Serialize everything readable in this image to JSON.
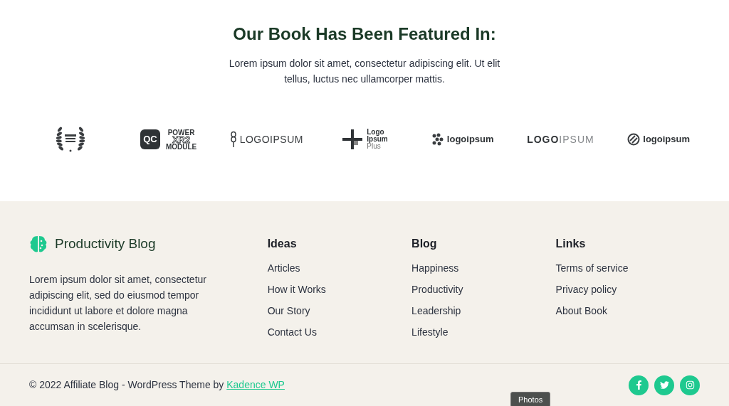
{
  "featured": {
    "title": "Our Book Has Been Featured In:",
    "text": "Lorem ipsum dolor sit amet, consectetur adipiscing elit. Ut elit tellus, luctus nec ullamcorper mattis.",
    "logos": [
      {
        "kind": "laurel"
      },
      {
        "kind": "qc",
        "badge": "QC",
        "lines": [
          "POWER",
          "XR2",
          "MODULE"
        ]
      },
      {
        "kind": "wheat",
        "lines": [
          "LOGOIPSUM"
        ]
      },
      {
        "kind": "cross",
        "lines": [
          "Logo",
          "Ipsum",
          "Plus"
        ]
      },
      {
        "kind": "dots",
        "lines": [
          "logoipsum"
        ]
      },
      {
        "kind": "split",
        "lines": [
          "LOGO",
          "IPSUM"
        ]
      },
      {
        "kind": "circle",
        "lines": [
          "logoipsum"
        ]
      }
    ]
  },
  "footer": {
    "brand": "Productivity Blog",
    "about": "Lorem ipsum dolor sit amet, consectetur adipiscing elit, sed do eiusmod tempor incididunt ut labore et dolore magna accumsan in scelerisque.",
    "columns": [
      {
        "title": "Ideas",
        "links": [
          "Articles",
          "How it Works",
          "Our Story",
          "Contact Us"
        ]
      },
      {
        "title": "Blog",
        "links": [
          "Happiness",
          "Productivity",
          "Leadership",
          "Lifestyle"
        ]
      },
      {
        "title": "Links",
        "links": [
          "Terms of service",
          "Privacy policy",
          "About Book"
        ]
      }
    ],
    "copyright": "© 2022 Affiliate Blog - WordPress Theme by",
    "credit_link": "Kadence WP",
    "social": [
      {
        "kind": "facebook"
      },
      {
        "kind": "twitter"
      },
      {
        "kind": "instagram"
      }
    ]
  },
  "tooltip": "Photos"
}
